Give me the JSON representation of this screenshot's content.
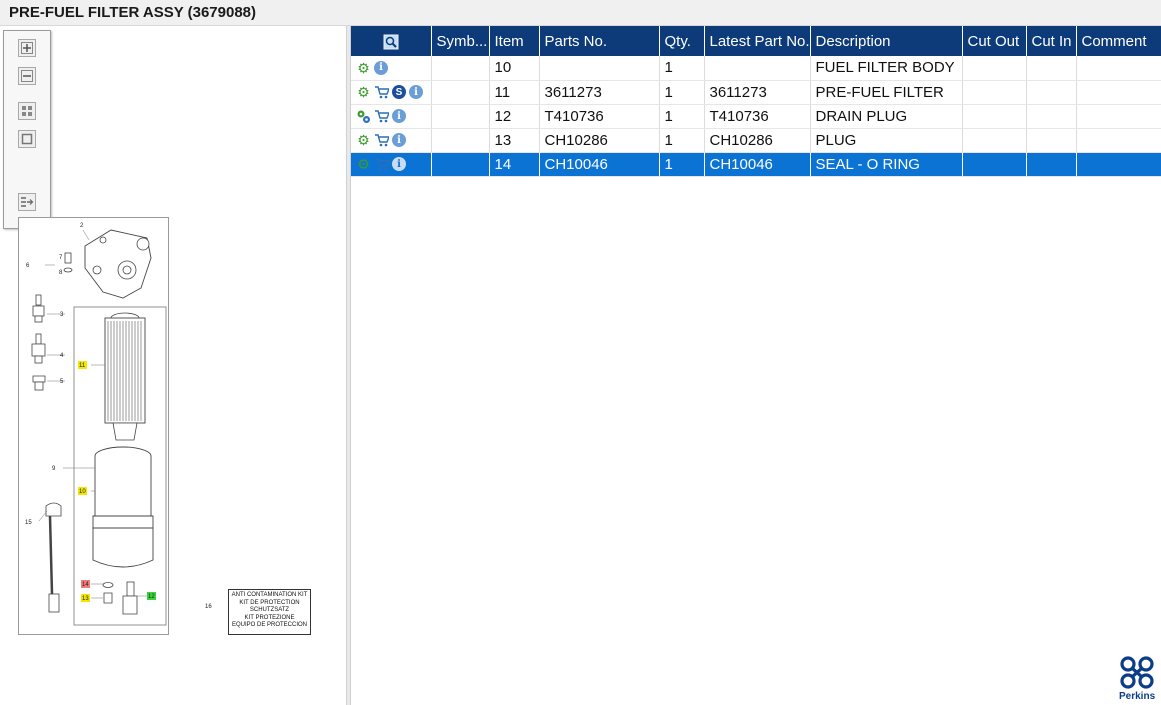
{
  "window": {
    "title": "PRE-FUEL FILTER ASSY (3679088)"
  },
  "zoom_toolbar": {
    "buttons": [
      {
        "name": "zoom-in-icon"
      },
      {
        "name": "zoom-out-icon"
      },
      {
        "name": "fit-all-icon"
      },
      {
        "name": "actual-size-icon"
      },
      {
        "name": "export-icon"
      }
    ]
  },
  "diagram": {
    "callouts": [
      "2",
      "7",
      "6",
      "8",
      "3",
      "4",
      "5",
      "11",
      "9",
      "10",
      "15",
      "14",
      "13",
      "12"
    ],
    "highlight_colors": {
      "yellow": "#f5e600",
      "red": "#f07a7a",
      "green": "#3ad43a"
    },
    "kit_ref": "16",
    "kit_text": [
      "ANTI CONTAMINATION KIT",
      "KIT DE PROTECTION",
      "SCHUTZSATZ",
      "KIT PROTEZIONE",
      "EQUIPO DE PROTECCION"
    ]
  },
  "table": {
    "headers": [
      "",
      "Symb...",
      "Item",
      "Parts No.",
      "Qty.",
      "Latest Part No.",
      "Description",
      "Cut Out",
      "Cut In",
      "Comment"
    ],
    "rows": [
      {
        "icons": [
          "gear-icon",
          "info-icon"
        ],
        "symbol": "",
        "item": "10",
        "part_no": "",
        "qty": "1",
        "latest": "",
        "description": "FUEL FILTER BODY",
        "cut_out": "",
        "cut_in": "",
        "comment": "",
        "selected": false
      },
      {
        "icons": [
          "gear-icon",
          "cart-icon",
          "s-badge-icon",
          "info-icon"
        ],
        "symbol": "",
        "item": "11",
        "part_no": "3611273",
        "qty": "1",
        "latest": "3611273",
        "description": "PRE-FUEL FILTER",
        "cut_out": "",
        "cut_in": "",
        "comment": "",
        "selected": false
      },
      {
        "icons": [
          "gears-icon",
          "cart-icon",
          "info-icon"
        ],
        "symbol": "",
        "item": "12",
        "part_no": "T410736",
        "qty": "1",
        "latest": "T410736",
        "description": "DRAIN PLUG",
        "cut_out": "",
        "cut_in": "",
        "comment": "",
        "selected": false
      },
      {
        "icons": [
          "gear-icon",
          "cart-icon",
          "info-icon"
        ],
        "symbol": "",
        "item": "13",
        "part_no": "CH10286",
        "qty": "1",
        "latest": "CH10286",
        "description": "PLUG",
        "cut_out": "",
        "cut_in": "",
        "comment": "",
        "selected": false
      },
      {
        "icons": [
          "gear-icon",
          "cart-icon",
          "info-icon"
        ],
        "symbol": "",
        "item": "14",
        "part_no": "CH10046",
        "qty": "1",
        "latest": "CH10046",
        "description": "SEAL - O RING",
        "cut_out": "",
        "cut_in": "",
        "comment": "",
        "selected": true
      }
    ]
  },
  "logo": {
    "word": "Perkins",
    "color": "#0c3d87"
  },
  "colors": {
    "header_bg": "#0d3b7a",
    "selected_row": "#0b73d4",
    "gear": "#3d9a2c"
  }
}
